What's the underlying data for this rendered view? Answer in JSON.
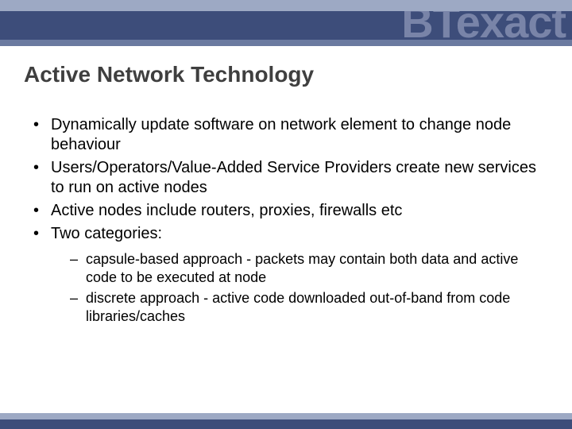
{
  "brand": "BTexact",
  "title": "Active Network Technology",
  "bullets": [
    {
      "text": "Dynamically update software on network element to change node behaviour"
    },
    {
      "text": "Users/Operators/Value-Added Service Providers create new services to run on active nodes"
    },
    {
      "text": "Active nodes include routers, proxies, firewalls etc"
    },
    {
      "text": "Two categories:",
      "sub": [
        "capsule-based approach - packets may contain both data and active code to be executed at node",
        "discrete approach - active code downloaded out-of-band from code libraries/caches"
      ]
    }
  ]
}
